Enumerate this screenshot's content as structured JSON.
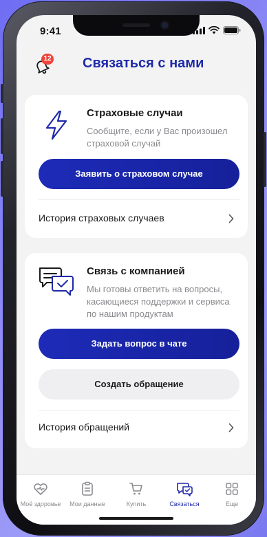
{
  "status_bar": {
    "time": "9:41"
  },
  "header": {
    "title": "Связаться с нами",
    "notification_count": "12",
    "bell_icon": "bell-icon"
  },
  "insurance_card": {
    "icon": "lightning-icon",
    "title": "Страховые случаи",
    "description": "Сообщите, если у Вас произошел страховой случай",
    "primary_button": "Заявить о страховом случае",
    "history_link": "История страховых случаев"
  },
  "company_card": {
    "icon": "chat-bubbles-icon",
    "title": "Связь с компанией",
    "description": "Мы готовы ответить на вопросы, касающиеся поддержки и сервиса по нашим продуктам",
    "primary_button": "Задать вопрос в чате",
    "secondary_button": "Создать обращение",
    "history_link": "История обращений"
  },
  "bottom_nav": {
    "items": [
      {
        "label": "Моё здоровье",
        "icon": "heart-icon",
        "active": false
      },
      {
        "label": "Мои данные",
        "icon": "clipboard-icon",
        "active": false
      },
      {
        "label": "Купить",
        "icon": "cart-icon",
        "active": false
      },
      {
        "label": "Связаться",
        "icon": "chat-icon",
        "active": true
      },
      {
        "label": "Еще",
        "icon": "grid-icon",
        "active": false
      }
    ]
  },
  "colors": {
    "accent": "#1f2aa8",
    "badge": "#f0443a",
    "background": "#f3f3f4",
    "muted_text": "#8a8a8f"
  }
}
